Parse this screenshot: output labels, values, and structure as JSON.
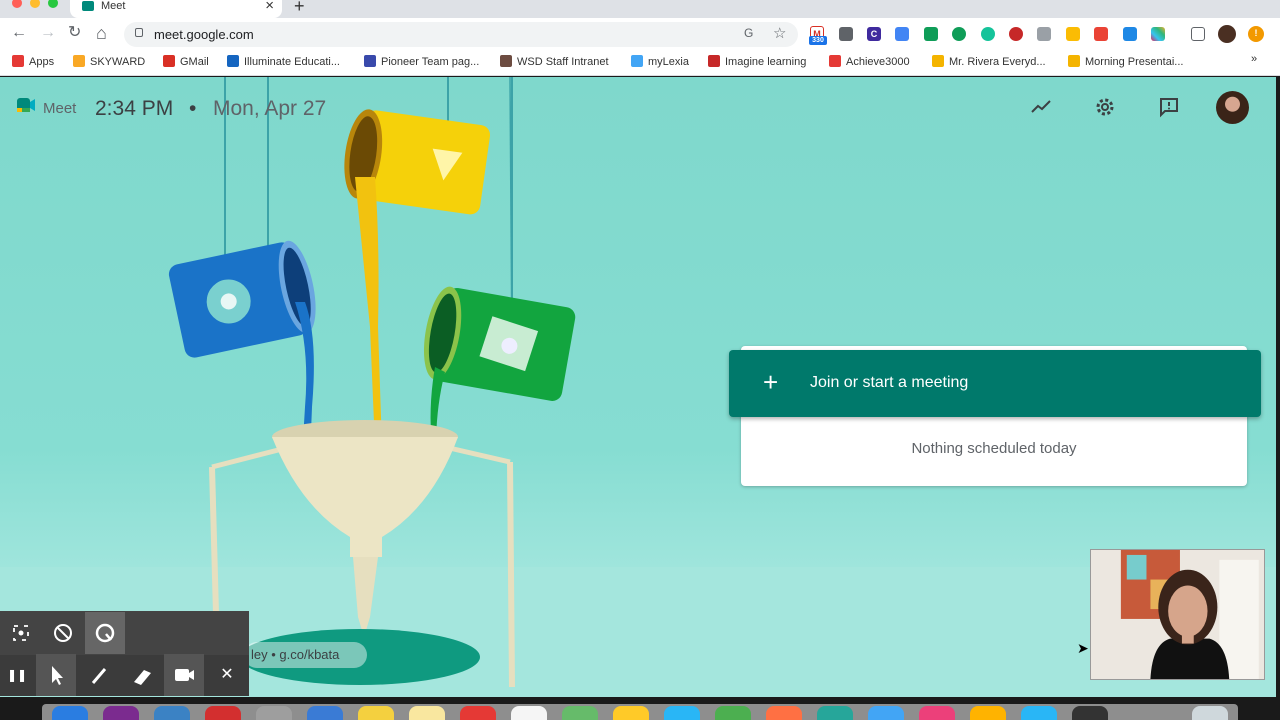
{
  "browser": {
    "tab_title": "Meet",
    "tab_close": "×",
    "new_tab": "+",
    "url": "meet.google.com",
    "nav": {
      "back": "←",
      "forward": "→",
      "reload": "↻",
      "home": "⌂"
    },
    "star": "☆",
    "translate": "G",
    "extension_badge": "330"
  },
  "bookmarks": [
    {
      "label": "Apps",
      "color": "#e53935"
    },
    {
      "label": "SKYWARD",
      "color": "#f9a825"
    },
    {
      "label": "GMail",
      "color": "#d93025"
    },
    {
      "label": "Illuminate Educati...",
      "color": "#1565c0"
    },
    {
      "label": "Pioneer Team pag...",
      "color": "#3949ab"
    },
    {
      "label": "WSD Staff Intranet",
      "color": "#6d4c41"
    },
    {
      "label": "myLexia",
      "color": "#42a5f5"
    },
    {
      "label": "Imagine learning",
      "color": "#c62828"
    },
    {
      "label": "Achieve3000",
      "color": "#e53935"
    },
    {
      "label": "Mr. Rivera Everyd...",
      "color": "#f4b400"
    },
    {
      "label": "Morning Presentai...",
      "color": "#f4b400"
    }
  ],
  "bookmarks_more": "»",
  "meet": {
    "app_name": "Meet",
    "time": "2:34 PM",
    "separator": "•",
    "date": "Mon, Apr 27",
    "join_plus": "+",
    "join_label": "Join or start a meeting",
    "empty_state": "Nothing scheduled today",
    "pill_text": "ley  •  g.co/kbata"
  },
  "colors": {
    "meet_green": "#00796b",
    "page_bg": "#86ddd2"
  },
  "screencast_tools": {
    "pause": "❚❚",
    "close": "✕"
  }
}
